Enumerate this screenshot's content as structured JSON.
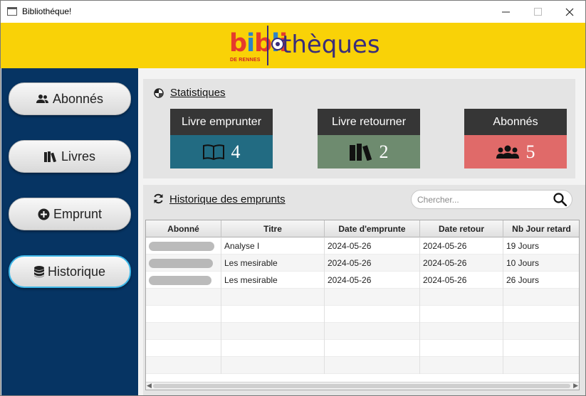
{
  "window": {
    "title": "Bibliothéque!",
    "icons": {
      "minimize": "minimize-icon",
      "maximize": "maximize-icon",
      "close": "close-icon"
    }
  },
  "banner": {
    "logo_left": "biblio",
    "logo_right": "thèques",
    "logo_sub": "DE RENNES",
    "colors": {
      "background": "#f9d207",
      "text": "#3a2d7a"
    }
  },
  "sidebar": {
    "items": [
      {
        "label": "Abonnés",
        "icon": "users-icon"
      },
      {
        "label": "Livres",
        "icon": "books-icon"
      },
      {
        "label": "Emprunt",
        "icon": "plus-circle-icon"
      },
      {
        "label": "Historique",
        "icon": "database-icon",
        "active": true
      }
    ]
  },
  "stats": {
    "title": "Statistiques",
    "cards": [
      {
        "label": "Livre emprunter",
        "value": "4",
        "icon": "open-book-icon",
        "color": "#226b82"
      },
      {
        "label": "Livre retourner",
        "value": "2",
        "icon": "books-icon",
        "color": "#6e8b6f"
      },
      {
        "label": "Abonnés",
        "value": "5",
        "icon": "users-icon",
        "color": "#e06a69"
      }
    ]
  },
  "history": {
    "title": "Historique des emprunts",
    "search_placeholder": "Chercher...",
    "columns": [
      "Abonné",
      "Titre",
      "Date  d'emprunte",
      "Date retour",
      "Nb Jour retard"
    ],
    "rows": [
      {
        "abonne": "",
        "titre": "Analyse I",
        "date_emprunt": "2024-05-26",
        "date_retour": "2024-05-26",
        "retard": "19 Jours"
      },
      {
        "abonne": "",
        "titre": "Les mesirable",
        "date_emprunt": "2024-05-26",
        "date_retour": "2024-05-26",
        "retard": "10 Jours"
      },
      {
        "abonne": "",
        "titre": "Les mesirable",
        "date_emprunt": "2024-05-26",
        "date_retour": "2024-05-26",
        "retard": "26 Jours"
      }
    ]
  }
}
